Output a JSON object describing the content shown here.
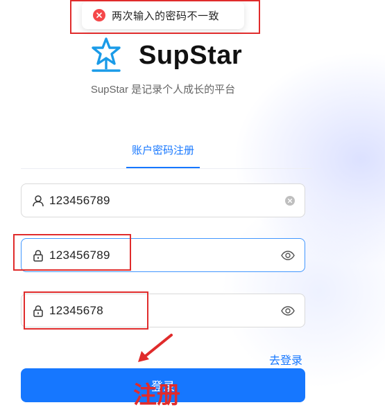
{
  "toast": {
    "message": "两次输入的密码不一致",
    "type": "error"
  },
  "brand": {
    "name": "SupStar",
    "subtitle": "SupStar 是记录个人成长的平台"
  },
  "tabs": [
    {
      "label": "账户密码注册",
      "active": true
    }
  ],
  "form": {
    "username": {
      "value": "123456789"
    },
    "password": {
      "value": "123456789"
    },
    "confirm_password": {
      "value": "12345678"
    },
    "login_link": "去登录",
    "submit_label": "登录"
  },
  "annotation": {
    "label": "注册"
  },
  "colors": {
    "primary": "#1677ff",
    "error": "#f5484a",
    "annotation": "#e02b2b"
  },
  "icons": [
    "error-icon",
    "star-logo-icon",
    "user-icon",
    "lock-icon",
    "eye-icon",
    "clear-icon",
    "arrow-annotation"
  ]
}
